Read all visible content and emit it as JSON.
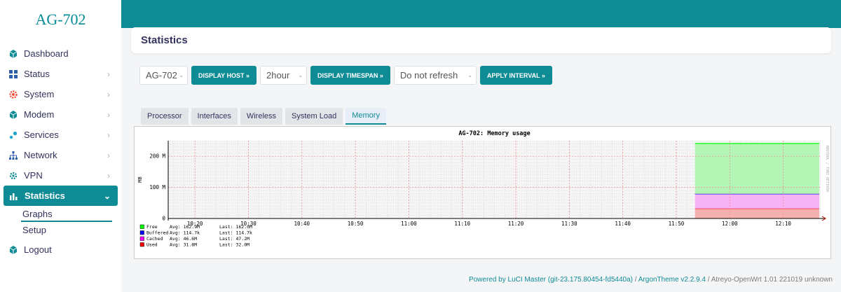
{
  "brand": "AG-702",
  "sidebar": {
    "items": [
      {
        "label": "Dashboard",
        "icon": "cube-icon"
      },
      {
        "label": "Status",
        "icon": "grid-icon",
        "chevron": "›"
      },
      {
        "label": "System",
        "icon": "gear-icon",
        "chevron": "›"
      },
      {
        "label": "Modem",
        "icon": "cube-icon",
        "chevron": "›"
      },
      {
        "label": "Services",
        "icon": "services-icon",
        "chevron": "›"
      },
      {
        "label": "Network",
        "icon": "network-icon",
        "chevron": "›"
      },
      {
        "label": "VPN",
        "icon": "vpn-icon",
        "chevron": "›"
      },
      {
        "label": "Statistics",
        "icon": "bar-chart-icon",
        "chevron": "⌄"
      },
      {
        "label": "Logout",
        "icon": "cube-icon"
      }
    ],
    "sub": [
      "Graphs",
      "Setup"
    ]
  },
  "page_title": "Statistics",
  "controls": {
    "host": "AG-702",
    "display_host": "DISPLAY HOST »",
    "timespan": "2hour",
    "display_timespan": "DISPLAY TIMESPAN »",
    "refresh": "Do not refresh",
    "apply_interval": "APPLY INTERVAL »"
  },
  "tabs": [
    "Processor",
    "Interfaces",
    "Wireless",
    "System Load",
    "Memory"
  ],
  "active_tab": "Memory",
  "chart_data": {
    "type": "area",
    "title": "AG-702: Memory usage",
    "ylabel": "MB",
    "side_label": "RRDTOOL / TOBI OETIKER",
    "ylim": [
      0,
      250
    ],
    "yticks": [
      "0",
      "100 M",
      "200 M"
    ],
    "yticks_values": [
      0,
      100,
      200
    ],
    "x_tick_labels": [
      "10:20",
      "10:30",
      "10:40",
      "10:50",
      "11:00",
      "11:10",
      "11:20",
      "11:30",
      "11:40",
      "11:50",
      "12:00",
      "12:10"
    ],
    "x_tick_minutes": [
      620,
      630,
      640,
      650,
      660,
      670,
      680,
      690,
      700,
      710,
      720,
      730
    ],
    "x_range_minutes": [
      615,
      737
    ],
    "data_start_minute": 713.5,
    "series": [
      {
        "name": "Used",
        "avg": "31.8M",
        "last": "32.0M",
        "value": 32.0,
        "color": "#ff0000",
        "fill": "#f7b0b0"
      },
      {
        "name": "Cached",
        "avg": "46.6M",
        "last": "47.2M",
        "value": 47.2,
        "color": "#ff00ff",
        "fill": "#f6b4f6"
      },
      {
        "name": "Buffered",
        "avg": "114.7k",
        "last": "114.7k",
        "value": 0.1,
        "color": "#0000ff",
        "fill": "#0000ff"
      },
      {
        "name": "Free",
        "avg": "162.9M",
        "last": "162.0M",
        "value": 162.0,
        "color": "#00ff00",
        "fill": "#b4f4b4"
      }
    ],
    "legend": [
      {
        "name": "Free",
        "avg": "Avg:  162.9M",
        "last": "Last:  162.0M",
        "color": "#00ff00"
      },
      {
        "name": "Buffered",
        "avg": "Avg:  114.7k",
        "last": "Last:  114.7k",
        "color": "#0000ff"
      },
      {
        "name": "Cached",
        "avg": "Avg:   46.6M",
        "last": "Last:   47.2M",
        "color": "#ff00ff"
      },
      {
        "name": "Used",
        "avg": "Avg:   31.8M",
        "last": "Last:   32.0M",
        "color": "#ff0000"
      }
    ]
  },
  "footer": {
    "luci": "Powered by LuCI Master (git-23.175.80454-fd5440a)",
    "sep1": " / ",
    "theme": "ArgonTheme v2.2.9.4",
    "sep2": " / ",
    "fw": "Atreyo-OpenWrt 1.01 221019 unknown"
  }
}
